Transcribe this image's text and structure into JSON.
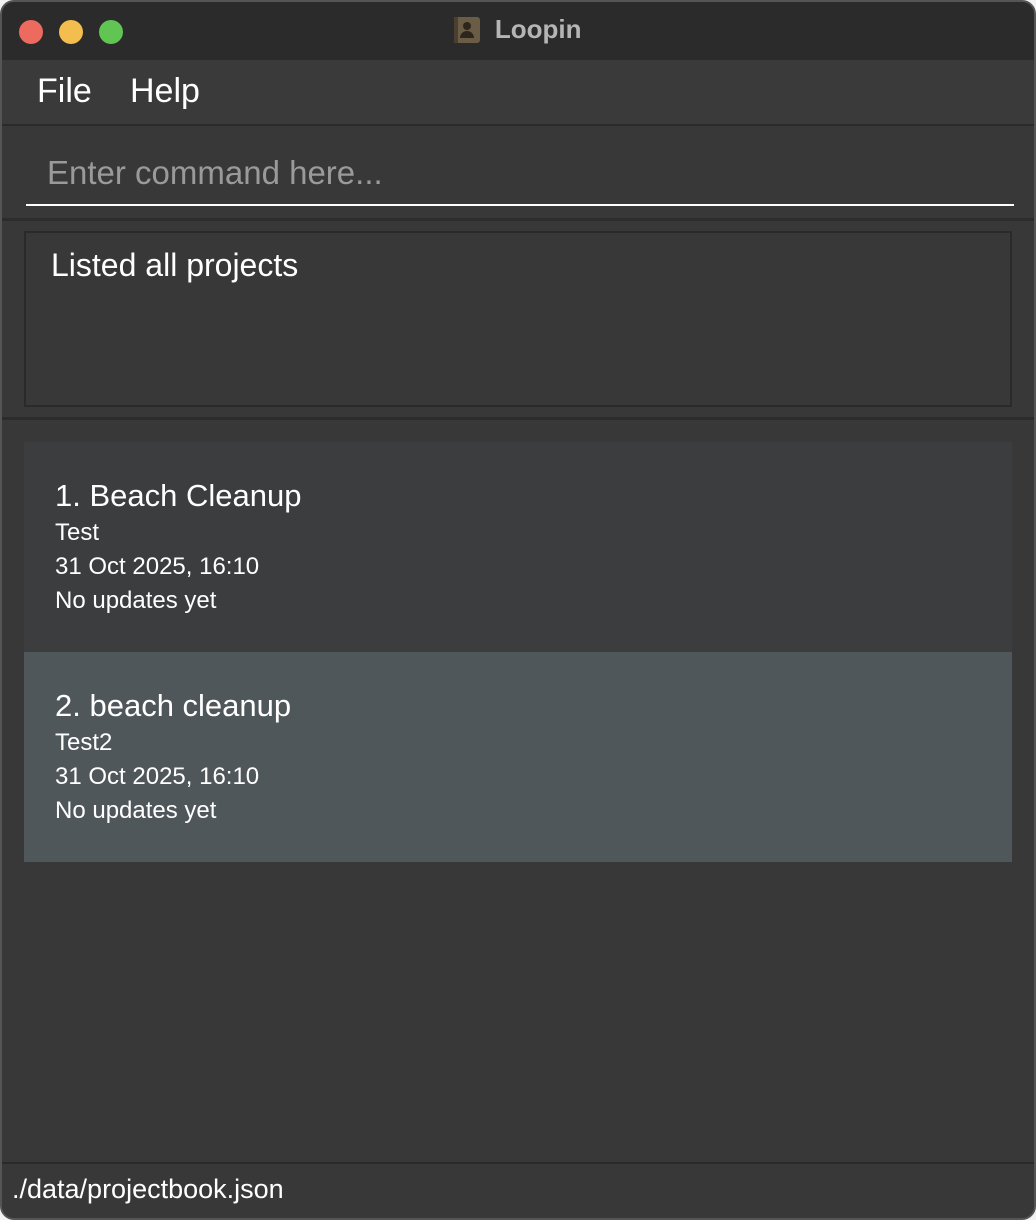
{
  "window": {
    "title": "Loopin"
  },
  "menu": {
    "file_label": "File",
    "help_label": "Help"
  },
  "command": {
    "placeholder": "Enter command here...",
    "value": ""
  },
  "result": {
    "message": "Listed all projects"
  },
  "projects": [
    {
      "index_name": "1. Beach Cleanup",
      "description": "Test",
      "datetime": "31 Oct 2025, 16:10",
      "updates": "No updates yet",
      "selected": false
    },
    {
      "index_name": "2. beach cleanup",
      "description": "Test2",
      "datetime": "31 Oct 2025, 16:10",
      "updates": "No updates yet",
      "selected": true
    }
  ],
  "status": {
    "file_path": "./data/projectbook.json"
  },
  "colors": {
    "background": "#383838",
    "card": "#3c3d3f",
    "card_selected": "#50575b",
    "text": "#ffffff",
    "close": "#ec6a5e",
    "minimize": "#f4be4f",
    "maximize": "#61c554"
  }
}
